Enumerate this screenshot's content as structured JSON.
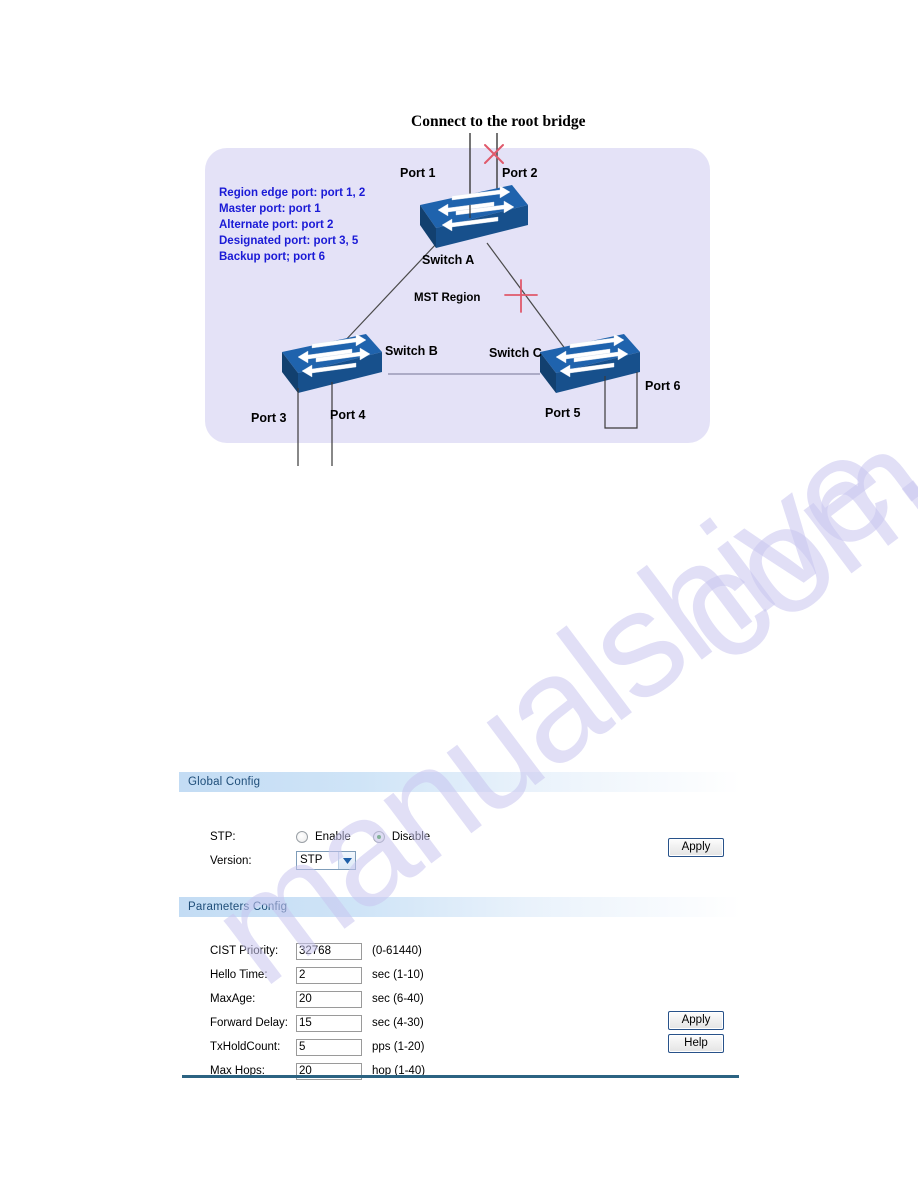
{
  "diagram": {
    "title": "Connect to the root bridge",
    "region_label": "MST Region",
    "legend": [
      "Region edge port: port 1, 2",
      "Master port: port 1",
      "Alternate port: port 2",
      "Designated port: port 3, 5",
      "Backup port; port 6"
    ],
    "switches": [
      {
        "name": "Switch A"
      },
      {
        "name": "Switch B"
      },
      {
        "name": "Switch C"
      }
    ],
    "ports": [
      {
        "label": "Port 1"
      },
      {
        "label": "Port 2"
      },
      {
        "label": "Port 3"
      },
      {
        "label": "Port 4"
      },
      {
        "label": "Port 5"
      },
      {
        "label": "Port 6"
      }
    ],
    "colors": {
      "panel_background": "#e4e2f7",
      "legend_text": "#1a1ad6",
      "switch_top": "#1a5a9e",
      "switch_front": "#154a80",
      "cross_mark": "#e05a6a",
      "link_line": "#3a3a3a"
    }
  },
  "global_config": {
    "header": "Global Config",
    "stp_label": "STP:",
    "stp_options": [
      {
        "label": "Enable",
        "selected": false
      },
      {
        "label": "Disable",
        "selected": true
      }
    ],
    "version_label": "Version:",
    "version_value": "STP",
    "apply_label": "Apply"
  },
  "parameters_config": {
    "header": "Parameters Config",
    "fields": [
      {
        "label": "CIST Priority:",
        "value": "32768",
        "hint": "(0-61440)"
      },
      {
        "label": "Hello Time:",
        "value": "2",
        "hint": "sec (1-10)"
      },
      {
        "label": "MaxAge:",
        "value": "20",
        "hint": "sec (6-40)"
      },
      {
        "label": "Forward Delay:",
        "value": "15",
        "hint": "sec (4-30)"
      },
      {
        "label": "TxHoldCount:",
        "value": "5",
        "hint": "pps (1-20)"
      },
      {
        "label": "Max Hops:",
        "value": "20",
        "hint": "hop (1-40)"
      }
    ],
    "apply_label": "Apply",
    "help_label": "Help"
  },
  "watermark": {
    "line1": "manualshive.",
    "line2": "com"
  }
}
